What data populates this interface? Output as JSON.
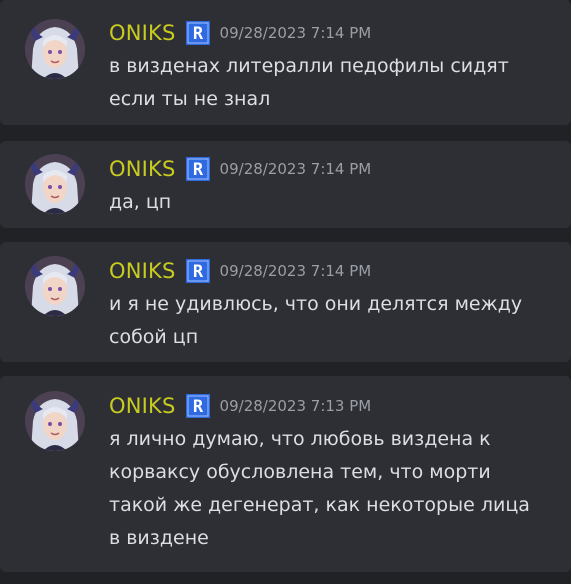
{
  "colors": {
    "background": "#202226",
    "message_bg": "#2d2f35",
    "username": "#c9cc1f",
    "timestamp": "#9b9ea5",
    "text": "#dcdee3",
    "badge_blue": "#2f6ae0"
  },
  "messages": [
    {
      "username": "ONIKS",
      "badge": "R",
      "timestamp": "09/28/2023 7:14 PM",
      "text": "в визденах литералли педофилы сидят\nесли ты не знал"
    },
    {
      "username": "ONIKS",
      "badge": "R",
      "timestamp": "09/28/2023 7:14 PM",
      "text": "да, цп"
    },
    {
      "username": "ONIKS",
      "badge": "R",
      "timestamp": "09/28/2023 7:14 PM",
      "text": "и я не удивлюсь, что они делятся между\nсобой цп"
    },
    {
      "username": "ONIKS",
      "badge": "R",
      "timestamp": "09/28/2023 7:13 PM",
      "text": "я лично думаю, что любовь виздена к\nкорваксу обусловлена тем, что морти\nтакой же дегенерат, как некоторые лица\nв виздене"
    }
  ]
}
